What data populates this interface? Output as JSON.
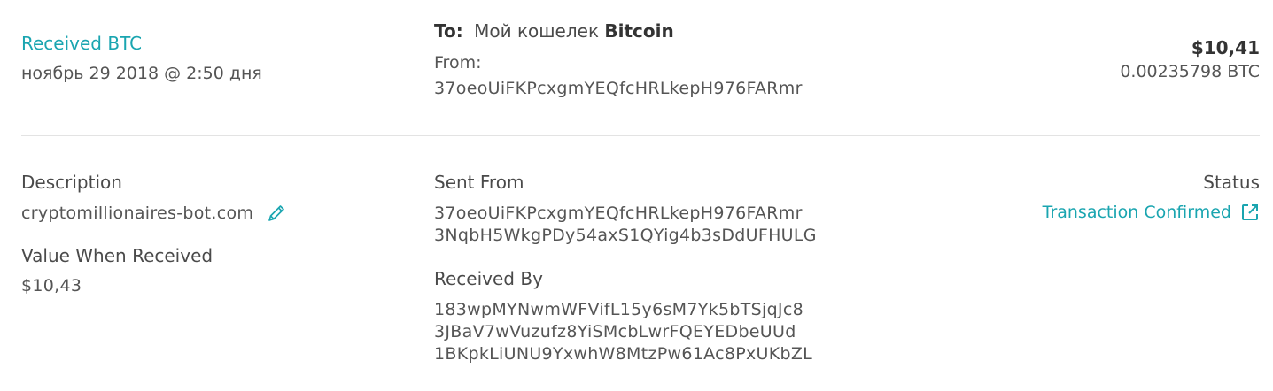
{
  "header": {
    "type": "Received BTC",
    "date": "ноябрь 29 2018 @ 2:50 дня",
    "to_label": "To:",
    "to_wallet_prefix": "Мой кошелек",
    "to_wallet_currency": "Bitcoin",
    "from_label": "From:",
    "from_address": "37oeoUiFKPcxgmYEQfcHRLkepH976FARmr",
    "amount_usd": "$10,41",
    "amount_btc": "0.00235798 BTC"
  },
  "details": {
    "description_label": "Description",
    "description_value": "cryptomillionaires-bot.com",
    "value_received_label": "Value When Received",
    "value_received": "$10,43",
    "sent_from_label": "Sent From",
    "sent_from": [
      "37oeoUiFKPcxgmYEQfcHRLkepH976FARmr",
      "3NqbH5WkgPDy54axS1QYig4b3sDdUFHULG"
    ],
    "received_by_label": "Received By",
    "received_by": [
      "183wpMYNwmWFVifL15y6sM7Yk5bTSjqJc8",
      "3JBaV7wVuzufz8YiSMcbLwrFQEYEDbeUUd",
      "1BKpkLiUNU9YxwhW8MtzPw61Ac8PxUKbZL"
    ],
    "status_label": "Status",
    "status_value": "Transaction Confirmed"
  },
  "icons": {
    "edit": "pencil-icon",
    "external": "external-link-icon"
  },
  "colors": {
    "accent": "#1aa5b0",
    "text": "#4a4a4a",
    "divider": "#e3e3e3"
  }
}
